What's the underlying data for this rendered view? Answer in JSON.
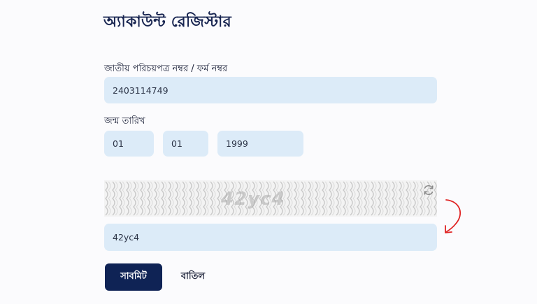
{
  "form": {
    "title": "অ্যাকাউন্ট রেজিস্টার",
    "nid_label": "জাতীয় পরিচয়পত্র নম্বর / ফর্ম নম্বর",
    "nid_value": "2403114749",
    "dob_label": "জন্ম তারিখ",
    "dob_day": "01",
    "dob_month": "01",
    "dob_year": "1999",
    "captcha_image_text": "42yc4",
    "captcha_value": "42yc4",
    "submit_label": "সাবমিট",
    "cancel_label": "বাতিল"
  },
  "icons": {
    "refresh": "refresh-icon",
    "annotation_arrow": "arrow-annotation-icon"
  },
  "colors": {
    "primary": "#0f2355",
    "input_bg": "#dcebf8",
    "annotation": "#e02424"
  }
}
